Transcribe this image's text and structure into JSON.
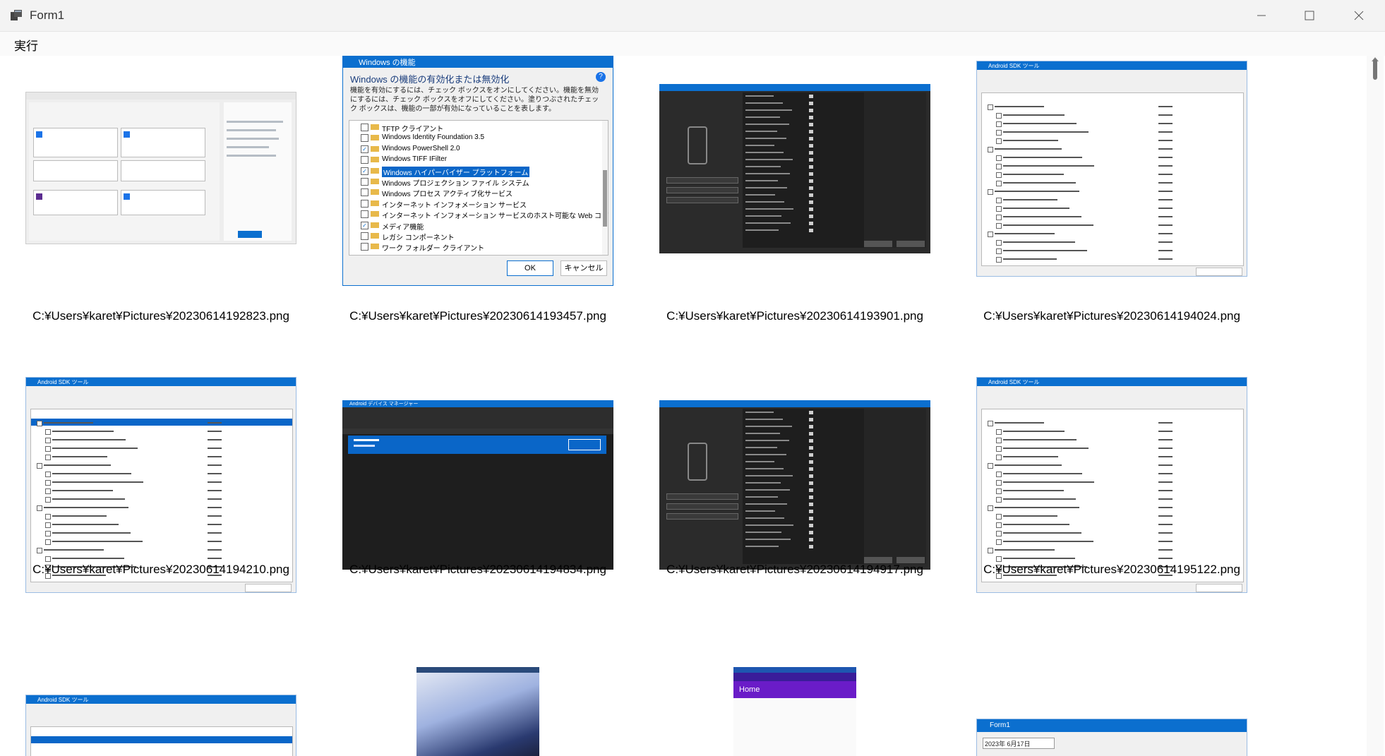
{
  "window": {
    "title": "Form1",
    "controls": {
      "minimize": "minimize-icon",
      "maximize": "maximize-icon",
      "close": "close-icon"
    }
  },
  "menu": {
    "run": "実行"
  },
  "thumbnails": [
    {
      "path": "C:¥Users¥karet¥Pictures¥20230614192823.png"
    },
    {
      "path": "C:¥Users¥karet¥Pictures¥20230614193457.png",
      "dialog_title": "Windows の機能",
      "heading": "Windows の機能の有効化または無効化",
      "description": "機能を有効にするには、チェック ボックスをオンにしてください。機能を無効にするには、チェック ボックスをオフにしてください。塗りつぶされたチェック ボックスは、機能の一部が有効になっていることを表します。",
      "features": [
        "TFTP クライアント",
        "Windows Identity Foundation 3.5",
        "Windows PowerShell 2.0",
        "Windows TIFF IFilter",
        "Windows ハイパーバイザー プラットフォーム",
        "Windows プロジェクション ファイル システム",
        "Windows プロセス アクティブ化サービス",
        "インターネット インフォメーション サービス",
        "インターネット インフォメーション サービスのホスト可能な Web コア",
        "メディア機能",
        "レガシ コンポーネント",
        "ワーク フォルダー クライアント"
      ],
      "ok": "OK",
      "cancel": "キャンセル"
    },
    {
      "path": "C:¥Users¥karet¥Pictures¥20230614193901.png"
    },
    {
      "path": "C:¥Users¥karet¥Pictures¥20230614194024.png",
      "dialog_title": "Android SDK ツール"
    },
    {
      "path": "C:¥Users¥karet¥Pictures¥20230614194210.png",
      "dialog_title": "Android SDK ツール"
    },
    {
      "path": "C:¥Users¥karet¥Pictures¥20230614194834.png",
      "dialog_title": "Android デバイス マネージャー"
    },
    {
      "path": "C:¥Users¥karet¥Pictures¥20230614194917.png"
    },
    {
      "path": "C:¥Users¥karet¥Pictures¥20230614195122.png",
      "dialog_title": "Android SDK ツール"
    }
  ],
  "partial_row": {
    "sdk_title": "Android SDK ツール",
    "phone_home": "Home",
    "form_title": "Form1",
    "date_value": "2023年 6月17日"
  },
  "colors": {
    "accent": "#0b6fcf",
    "selection": "#0a66c8",
    "dark_bg": "#2b2b2b"
  }
}
